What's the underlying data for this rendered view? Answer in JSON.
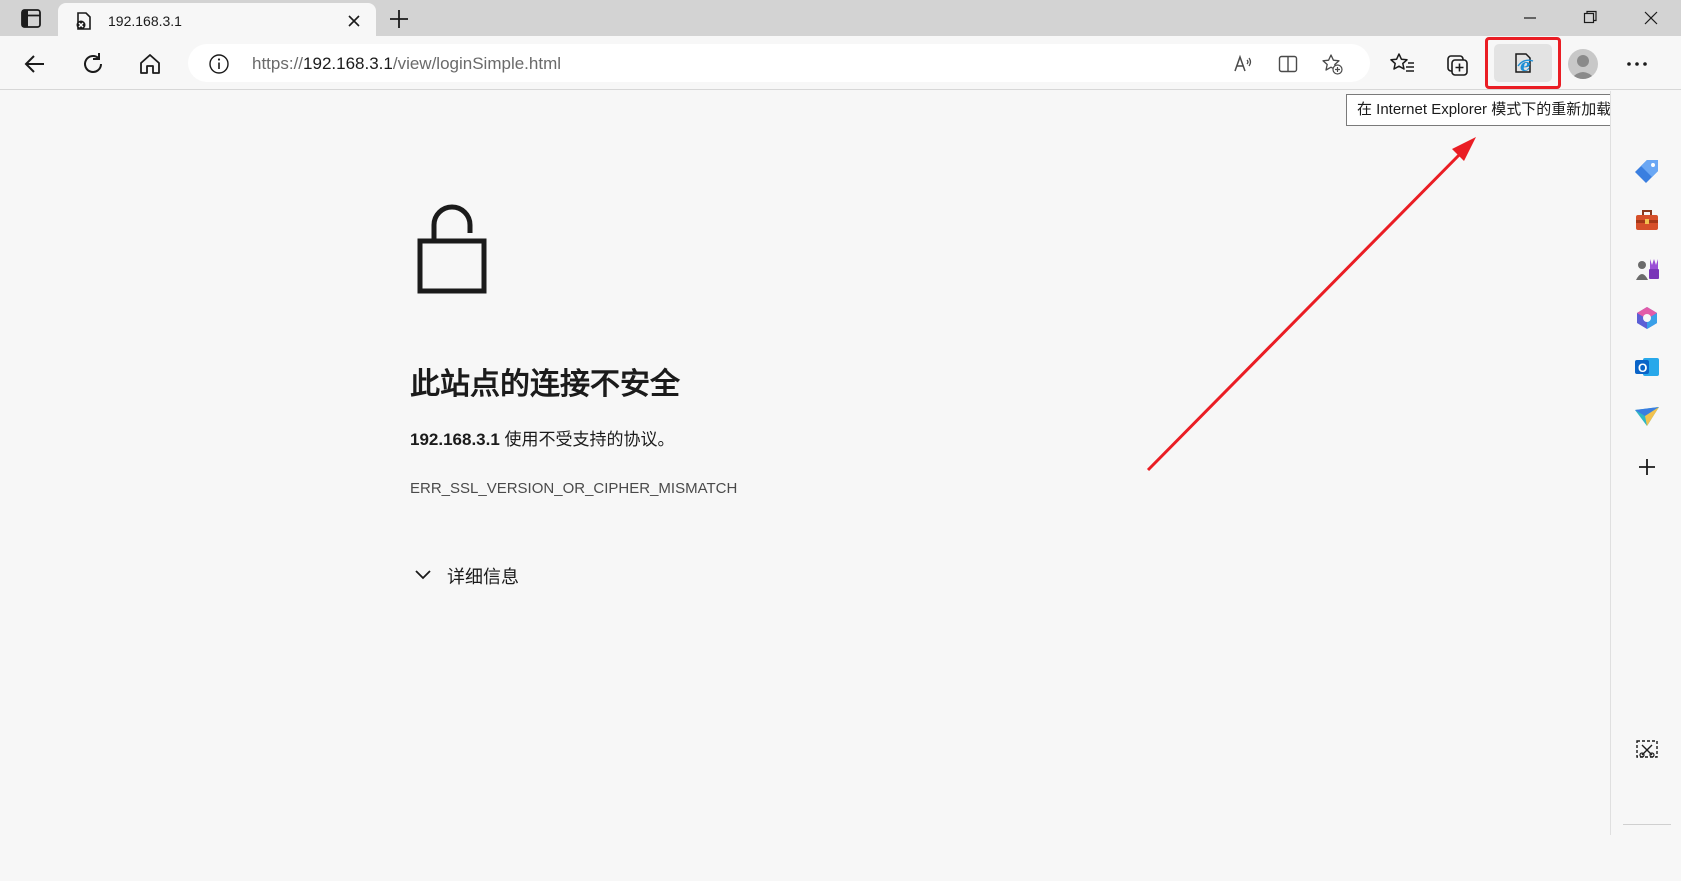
{
  "tab": {
    "title": "192.168.3.1"
  },
  "address": {
    "scheme": "https://",
    "host": "192.168.3.1",
    "path": "/view/loginSimple.html"
  },
  "tooltip": {
    "text": "在 Internet Explorer 模式下的重新加载选项卡"
  },
  "error": {
    "title": "此站点的连接不安全",
    "site": "192.168.3.1",
    "message": " 使用不受支持的协议。",
    "code": "ERR_SSL_VERSION_OR_CIPHER_MISMATCH",
    "details_label": "详细信息"
  },
  "toolbar_icons": [
    "back-icon",
    "refresh-icon",
    "home-icon",
    "site-info-icon",
    "read-aloud-icon",
    "split-screen-icon",
    "add-favorite-icon",
    "favorites-icon",
    "collections-icon",
    "ie-mode-icon",
    "profile-avatar",
    "more-icon"
  ],
  "sidebar_icons": [
    "shopping-tag-icon",
    "tools-briefcase-icon",
    "games-icon",
    "office-icon",
    "outlook-icon",
    "send-icon",
    "add-icon",
    "screenshot-icon"
  ],
  "colors": {
    "highlight": "#ea1d24",
    "page_bg": "#f7f7f7",
    "tab_strip": "#d3d3d3"
  }
}
